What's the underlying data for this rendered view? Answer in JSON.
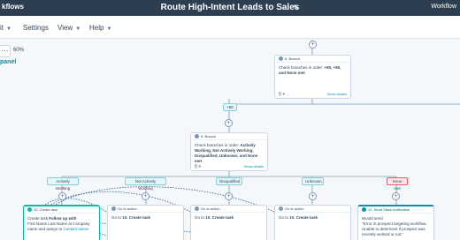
{
  "topbar": {
    "app_name": "kflows",
    "title": "Route High-Intent Leads to Sales",
    "right_label": "Workflow"
  },
  "menu": [
    {
      "label": "it"
    },
    {
      "label": "Settings"
    },
    {
      "label": "View"
    },
    {
      "label": "Help"
    }
  ],
  "canvas": {
    "zoom": "60%",
    "panel_label": "panel",
    "left_button": "←"
  },
  "branch_top": {
    "header": "8. Branch",
    "text": "Check branches in order: ",
    "order": "+90, +90, and None met",
    "show_details": "Show details"
  },
  "tag_90": "+90",
  "branch_mid": {
    "header": "9. Branch",
    "text": "Check branches in order: ",
    "order": "Actively Working, Not Actively Working, Disqualified, Unknown, and None met",
    "show_details": "Show details"
  },
  "branches": [
    {
      "label": "Actively Working"
    },
    {
      "label": "Not Actively Working"
    },
    {
      "label": "Disqualified"
    },
    {
      "label": "Unknown"
    },
    {
      "label": "None met"
    }
  ],
  "actions": [
    {
      "header": "10. Create task",
      "line1": "Create task ",
      "bold1": "Follow up with",
      "line2": "First Name  Last Name  at  Company name  and assign to ",
      "link": "Contact owner"
    },
    {
      "header": "Go to action",
      "line1": "Go to ",
      "bold1": "10. Create task"
    },
    {
      "header": "Go to action",
      "line1": "Go to ",
      "bold1": "10. Create task"
    },
    {
      "header": "Go to action",
      "line1": "Go to ",
      "bold1": "10. Create task"
    },
    {
      "header": "12. Send Slack notification",
      "line1": "Would send",
      "line2": "\"Error in prospect targeting workflow. Unable to determine if prospect was recently worked or not.\""
    }
  ]
}
